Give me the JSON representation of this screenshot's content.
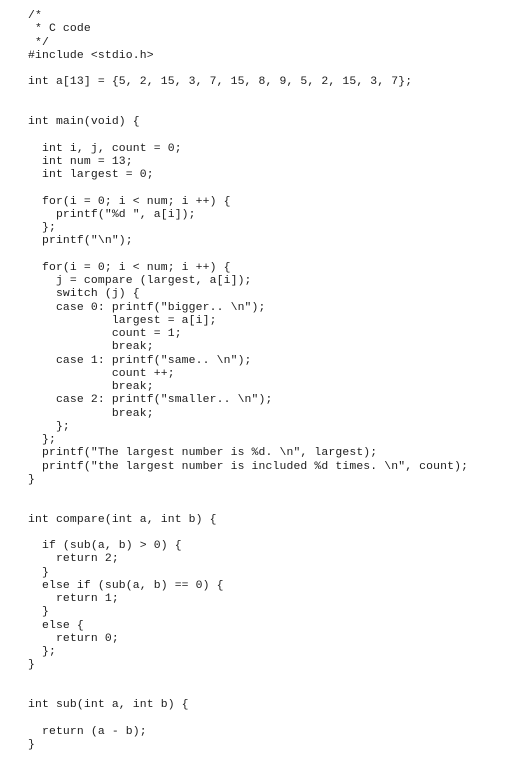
{
  "document": {
    "language": "C",
    "lines": [
      "/*",
      " * C code",
      " */",
      "#include <stdio.h>",
      "",
      "int a[13] = {5, 2, 15, 3, 7, 15, 8, 9, 5, 2, 15, 3, 7};",
      "",
      "",
      "int main(void) {",
      "",
      "  int i, j, count = 0;",
      "  int num = 13;",
      "  int largest = 0;",
      "",
      "  for(i = 0; i < num; i ++) {",
      "    printf(\"%d \", a[i]);",
      "  };",
      "  printf(\"\\n\");",
      "",
      "  for(i = 0; i < num; i ++) {",
      "    j = compare (largest, a[i]);",
      "    switch (j) {",
      "    case 0: printf(\"bigger.. \\n\");",
      "            largest = a[i];",
      "            count = 1;",
      "            break;",
      "    case 1: printf(\"same.. \\n\");",
      "            count ++;",
      "            break;",
      "    case 2: printf(\"smaller.. \\n\");",
      "            break;",
      "    };",
      "  };",
      "  printf(\"The largest number is %d. \\n\", largest);",
      "  printf(\"the largest number is included %d times. \\n\", count);",
      "}",
      "",
      "",
      "int compare(int a, int b) {",
      "",
      "  if (sub(a, b) > 0) {",
      "    return 2;",
      "  }",
      "  else if (sub(a, b) == 0) {",
      "    return 1;",
      "  }",
      "  else {",
      "    return 0;",
      "  };",
      "}",
      "",
      "",
      "int sub(int a, int b) {",
      "",
      "  return (a - b);",
      "}"
    ]
  }
}
